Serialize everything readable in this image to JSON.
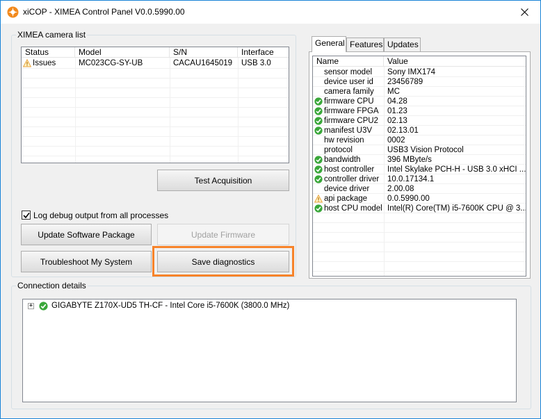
{
  "window": {
    "title": "xiCOP - XIMEA Control Panel V0.0.5990.00",
    "close_glyph": "✕"
  },
  "camera_list": {
    "group_label": "XIMEA camera list",
    "columns": [
      "Status",
      "Model",
      "S/N",
      "Interface"
    ],
    "rows": [
      {
        "status": "Issues",
        "status_icon": "warning-icon",
        "model": "MC023CG-SY-UB",
        "sn": "CACAU1645019",
        "interface": "USB 3.0"
      }
    ]
  },
  "buttons": {
    "test_acquisition": "Test Acquisition",
    "update_software": "Update Software Package",
    "update_firmware": "Update Firmware",
    "troubleshoot": "Troubleshoot My System",
    "save_diagnostics": "Save diagnostics"
  },
  "log_debug": {
    "label": "Log debug output from all processes",
    "checked": true
  },
  "tabs": [
    "General",
    "Features",
    "Updates"
  ],
  "properties": {
    "columns": [
      "Name",
      "Value"
    ],
    "rows": [
      {
        "icon": "",
        "name": "sensor model",
        "value": "Sony IMX174"
      },
      {
        "icon": "",
        "name": "device user id",
        "value": "23456789"
      },
      {
        "icon": "",
        "name": "camera family",
        "value": "MC"
      },
      {
        "icon": "ok",
        "name": "firmware CPU",
        "value": "04.28"
      },
      {
        "icon": "ok",
        "name": "firmware FPGA",
        "value": "01.23"
      },
      {
        "icon": "ok",
        "name": "firmware CPU2",
        "value": "02.13"
      },
      {
        "icon": "ok",
        "name": "manifest U3V",
        "value": "02.13.01"
      },
      {
        "icon": "",
        "name": "hw revision",
        "value": "0002"
      },
      {
        "icon": "",
        "name": "protocol",
        "value": "USB3 Vision Protocol"
      },
      {
        "icon": "ok",
        "name": "bandwidth",
        "value": "396 MByte/s"
      },
      {
        "icon": "ok",
        "name": "host controller",
        "value": "Intel Skylake PCH-H - USB 3.0 xHCI ..."
      },
      {
        "icon": "ok",
        "name": "controller driver",
        "value": "10.0.17134.1"
      },
      {
        "icon": "",
        "name": "device driver",
        "value": "2.00.08"
      },
      {
        "icon": "warn",
        "name": "api package",
        "value": "0.0.5990.00"
      },
      {
        "icon": "ok",
        "name": "host CPU model",
        "value": "Intel(R) Core(TM) i5-7600K CPU @ 3...."
      }
    ]
  },
  "connection": {
    "group_label": "Connection details",
    "tree_item": "GIGABYTE Z170X-UD5 TH-CF - Intel Core i5-7600K (3800.0 MHz)",
    "expander": "+",
    "status_icon": "ok"
  },
  "colors": {
    "accent_border": "#1883d7",
    "highlight": "#f7832a",
    "ok_green": "#3aa73a",
    "warn_orange": "#e8a33c"
  }
}
